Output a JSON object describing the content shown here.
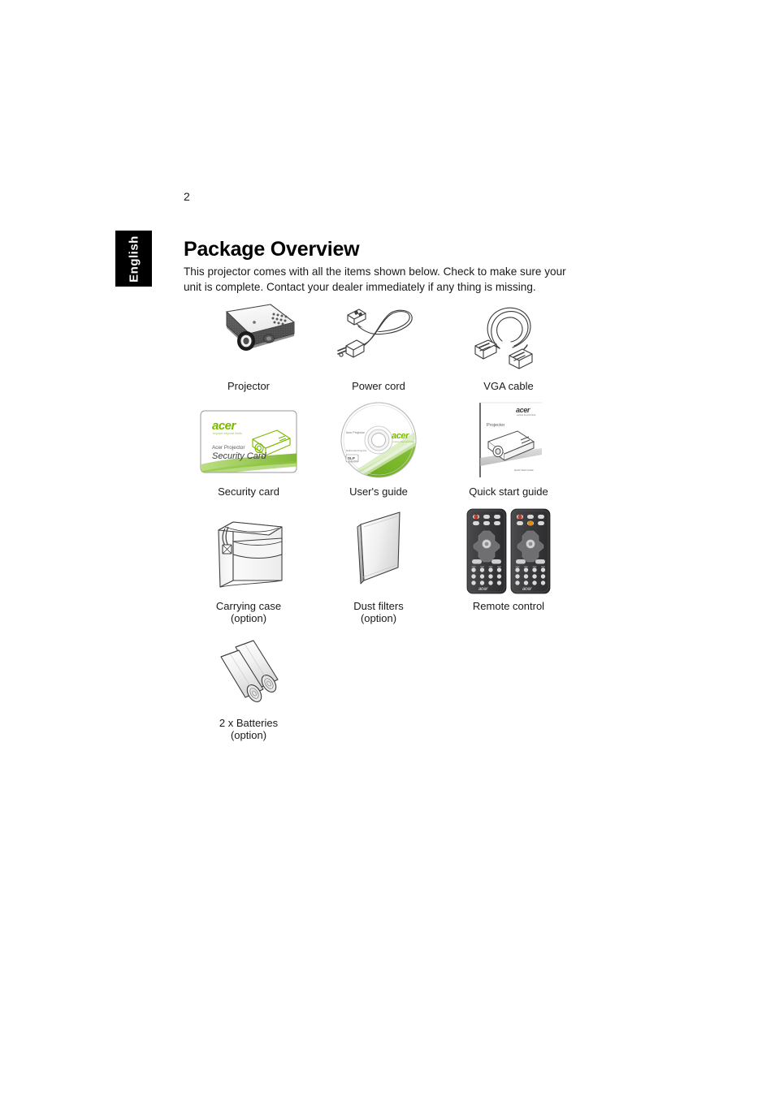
{
  "page": {
    "number": "2",
    "language_tab": "English"
  },
  "section": {
    "title": "Package Overview",
    "intro": "This projector comes with all the items shown below. Check to make sure your unit is complete. Contact your dealer immediately if any thing is missing."
  },
  "colors": {
    "acer_green": "#7ab800",
    "acer_green_dark": "#5f9400",
    "text": "#1a1a1a",
    "line": "#3a3a3a",
    "remote_body": "#3b3b3d",
    "remote_button": "#d9d9d9",
    "remote_red": "#c0392b",
    "remote_orange": "#e08a1e",
    "projector_dark": "#4a4a4a",
    "page_background": "#ffffff"
  },
  "items": [
    {
      "id": "projector",
      "icon": "projector-illustration",
      "label": "Projector",
      "sublabel": ""
    },
    {
      "id": "power-cord",
      "icon": "power-cord-illustration",
      "label": "Power cord",
      "sublabel": ""
    },
    {
      "id": "vga-cable",
      "icon": "vga-cable-illustration",
      "label": "VGA cable",
      "sublabel": ""
    },
    {
      "id": "security-card",
      "icon": "security-card-illustration",
      "label": "Security card",
      "sublabel": ""
    },
    {
      "id": "users-guide",
      "icon": "cd-disc-illustration",
      "label": "User's guide",
      "sublabel": ""
    },
    {
      "id": "quick-start-guide",
      "icon": "booklet-illustration",
      "label": "Quick start guide",
      "sublabel": ""
    },
    {
      "id": "carrying-case",
      "icon": "carrying-case-illustration",
      "label": "Carrying case",
      "sublabel": "(option)"
    },
    {
      "id": "dust-filters",
      "icon": "dust-filter-illustration",
      "label": "Dust filters",
      "sublabel": "(option)"
    },
    {
      "id": "remote-control",
      "icon": "remote-control-illustration",
      "label": "Remote control",
      "sublabel": ""
    },
    {
      "id": "batteries",
      "icon": "batteries-illustration",
      "label": "2 x Batteries",
      "sublabel": "(option)"
    }
  ],
  "artwork_text": {
    "security_card": {
      "brand": "acer",
      "tagline": "explore beyond limits",
      "line1": "Acer Projector",
      "line2": "Security Card"
    },
    "cd": {
      "brand": "acer",
      "tagline": "explore beyond limits",
      "side_text": "Acer Projector",
      "badge": "DLP"
    },
    "quick_start": {
      "brand": "acer",
      "tagline": "explore beyond limits",
      "product": "Projector",
      "footer": "Quick Start Guide"
    },
    "remote": {
      "brand": "acer"
    }
  }
}
